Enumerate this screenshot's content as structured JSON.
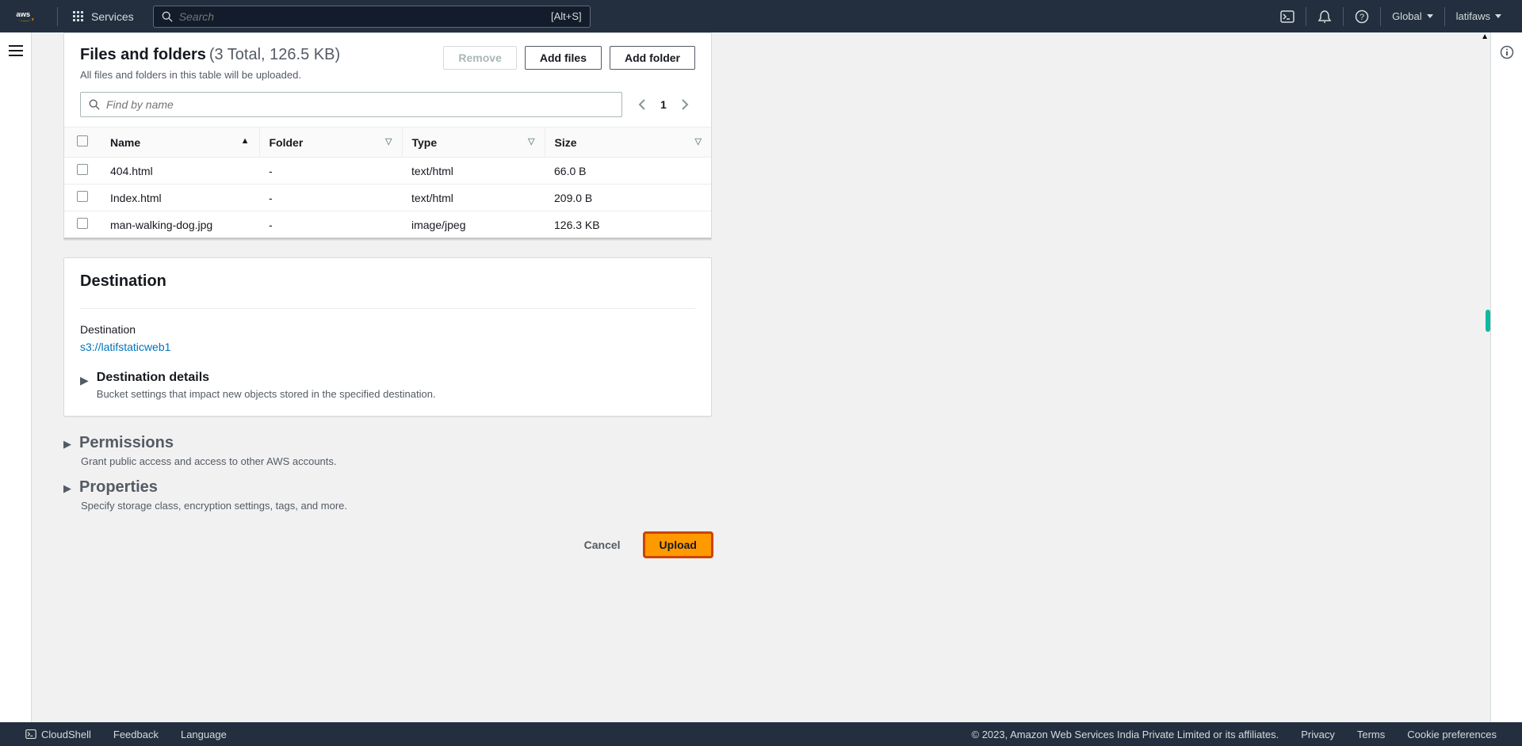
{
  "topnav": {
    "services": "Services",
    "search_placeholder": "Search",
    "search_shortcut": "[Alt+S]",
    "region": "Global",
    "user": "latifaws"
  },
  "files_panel": {
    "title": "Files and folders",
    "meta": "(3 Total, 126.5 KB)",
    "subtitle": "All files and folders in this table will be uploaded.",
    "remove": "Remove",
    "add_files": "Add files",
    "add_folder": "Add folder",
    "filter_placeholder": "Find by name",
    "page": "1",
    "cols": {
      "name": "Name",
      "folder": "Folder",
      "type": "Type",
      "size": "Size"
    },
    "rows": [
      {
        "name": "404.html",
        "folder": "-",
        "type": "text/html",
        "size": "66.0 B"
      },
      {
        "name": "Index.html",
        "folder": "-",
        "type": "text/html",
        "size": "209.0 B"
      },
      {
        "name": "man-walking-dog.jpg",
        "folder": "-",
        "type": "image/jpeg",
        "size": "126.3 KB"
      }
    ]
  },
  "destination": {
    "title": "Destination",
    "label": "Destination",
    "value": "s3://latifstaticweb1",
    "details_title": "Destination details",
    "details_sub": "Bucket settings that impact new objects stored in the specified destination."
  },
  "permissions": {
    "title": "Permissions",
    "sub": "Grant public access and access to other AWS accounts."
  },
  "properties": {
    "title": "Properties",
    "sub": "Specify storage class, encryption settings, tags, and more."
  },
  "actions": {
    "cancel": "Cancel",
    "upload": "Upload"
  },
  "bottombar": {
    "cloudshell": "CloudShell",
    "feedback": "Feedback",
    "language": "Language",
    "copyright": "© 2023, Amazon Web Services India Private Limited or its affiliates.",
    "privacy": "Privacy",
    "terms": "Terms",
    "cookies": "Cookie preferences"
  }
}
